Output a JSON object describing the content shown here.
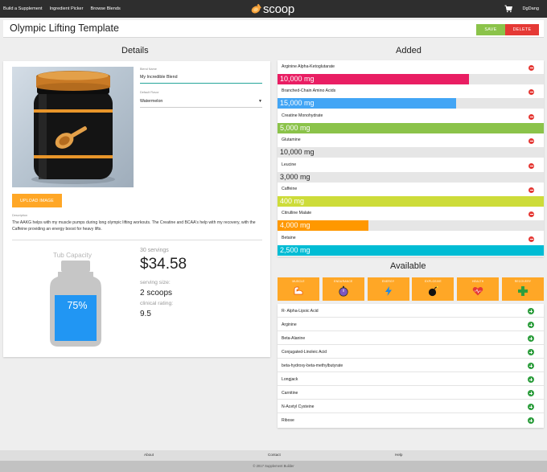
{
  "nav": {
    "links": [
      "Build a Supplement",
      "Ingredient Picker",
      "Browse Blends"
    ],
    "logo_text": "scoop",
    "user": "DgDang"
  },
  "title": "Olympic Lifting Template",
  "actions": {
    "save": "SAVE",
    "delete": "DELETE"
  },
  "details": {
    "heading": "Details",
    "blend_name_label": "Blend Name",
    "blend_name": "My Incredible Blend",
    "flavor_label": "Default Flavor",
    "flavor": "Watermelon",
    "upload_label": "UPLOAD IMAGE",
    "description_label": "Description",
    "description": "The AAKG helps with my muscle pumps during long olympic lifting workouts. The Creatine and BCAA's help with my recovery, with the Caffeine providing an energy boost for heavy lifts.",
    "tub_title": "Tub Capacity",
    "tub_percent_text": "75%",
    "tub_fill": 0.75,
    "servings": "30 servings",
    "price": "$34.58",
    "serving_size_label": "serving size:",
    "serving_size": "2 scoops",
    "rating_label": "clinical rating:",
    "rating": "9.5"
  },
  "added": {
    "heading": "Added",
    "items": [
      {
        "name": "Arginine Alpha-Ketoglutarate",
        "amount": "10,000 mg",
        "fill": 0.72,
        "color": "#e91e63"
      },
      {
        "name": "Branched-Chain Amino Acids",
        "amount": "15,000 mg",
        "fill": 0.67,
        "color": "#42a5f5"
      },
      {
        "name": "Creatine Monohydrate",
        "amount": "5,000 mg",
        "fill": 1.0,
        "color": "#8bc34a"
      },
      {
        "name": "Glutamine",
        "amount": "10,000 mg",
        "fill": 0.0,
        "color": "#e6e6e6"
      },
      {
        "name": "Leucine",
        "amount": "3,000 mg",
        "fill": 0.0,
        "color": "#e6e6e6"
      },
      {
        "name": "Caffeine",
        "amount": "400 mg",
        "fill": 1.0,
        "color": "#cddc39"
      },
      {
        "name": "Citrulline Malate",
        "amount": "4,000 mg",
        "fill": 0.34,
        "color": "#ff9800"
      },
      {
        "name": "Betaine",
        "amount": "2,500 mg",
        "fill": 1.0,
        "color": "#00bcd4"
      }
    ]
  },
  "available": {
    "heading": "Available",
    "categories": [
      {
        "label": "MUSCLE",
        "icon": "muscle-icon"
      },
      {
        "label": "ENDURANCE",
        "icon": "stopwatch-icon"
      },
      {
        "label": "ENERGY",
        "icon": "lightning-icon"
      },
      {
        "label": "EXPLOSIVE",
        "icon": "bomb-icon"
      },
      {
        "label": "HEALTH",
        "icon": "heart-icon"
      },
      {
        "label": "RECOVERY",
        "icon": "medical-cross-icon"
      }
    ],
    "items": [
      "R- Alpha-Lipoic Acid",
      "Arginine",
      "Beta-Alanine",
      "Conjugated-Linoleic Acid",
      "beta-hydroxy-beta-methylbutyrate",
      "Longjack",
      "Carnitine",
      "N-Acetyl Cysteine",
      "Ribose"
    ]
  },
  "footer": {
    "links": [
      "About",
      "Contact",
      "Help"
    ],
    "copyright": "© 2017 Supplement Builder"
  },
  "colors": {
    "nav_bg": "#2e2e2e",
    "accent_orange": "#ffa726",
    "save_green": "#8bc34a",
    "delete_red": "#e53935",
    "add_green": "#2e9e3e",
    "tub_blue": "#2196f3"
  }
}
